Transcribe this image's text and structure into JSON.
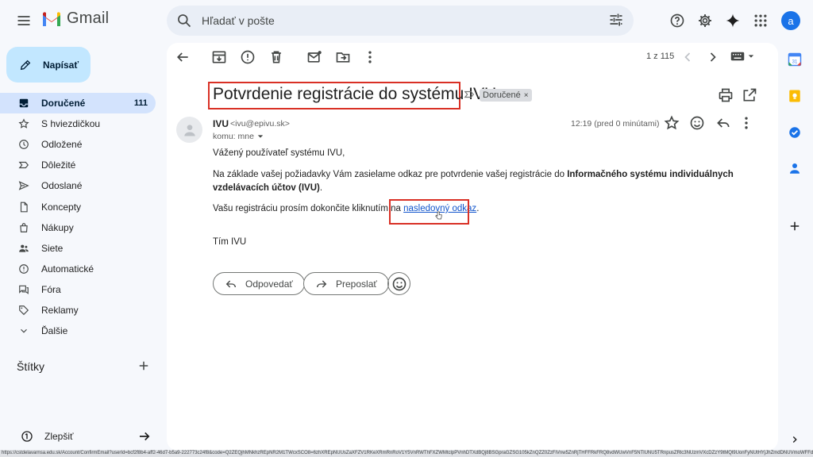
{
  "app": {
    "name": "Gmail",
    "brand_colors": {
      "red": "#ea4335",
      "blue": "#4285f4",
      "green": "#34a853",
      "yellow": "#fbbc04"
    }
  },
  "header": {
    "search_placeholder": "Hľadať v pošte",
    "account_initial": "a"
  },
  "compose": {
    "label": "Napísať"
  },
  "sidebar": {
    "items": [
      {
        "label": "Doručené",
        "count": "111",
        "icon": "inbox-icon",
        "active": true
      },
      {
        "label": "S hviezdičkou",
        "count": "",
        "icon": "star-icon",
        "active": false
      },
      {
        "label": "Odložené",
        "count": "",
        "icon": "clock-icon",
        "active": false
      },
      {
        "label": "Dôležité",
        "count": "",
        "icon": "important-icon",
        "active": false
      },
      {
        "label": "Odoslané",
        "count": "",
        "icon": "send-icon",
        "active": false
      },
      {
        "label": "Koncepty",
        "count": "",
        "icon": "draft-icon",
        "active": false
      },
      {
        "label": "Nákupy",
        "count": "",
        "icon": "shopping-icon",
        "active": false
      },
      {
        "label": "Siete",
        "count": "",
        "icon": "social-icon",
        "active": false
      },
      {
        "label": "Automatické",
        "count": "",
        "icon": "updates-icon",
        "active": false
      },
      {
        "label": "Fóra",
        "count": "",
        "icon": "forums-icon",
        "active": false
      },
      {
        "label": "Reklamy",
        "count": "",
        "icon": "tag-icon",
        "active": false
      },
      {
        "label": "Ďalšie",
        "count": "",
        "icon": "chevron-down-icon",
        "active": false
      }
    ],
    "labels_title": "Štítky",
    "upgrade_label": "Zlepšiť"
  },
  "toolbar": {
    "page_count": "1 z 115"
  },
  "message": {
    "subject": "Potvrdenie registrácie do systému IVU",
    "label_chip": "Doručené",
    "sender_name": "IVU",
    "sender_email": "<ivu@epivu.sk>",
    "recipient": "komu: mne",
    "time": "12:19 (pred 0 minútami)",
    "greeting": "Vážený používateľ systému IVU,",
    "para1_start": "Na základe vašej požiadavky Vám zasielame odkaz pre potvrdenie vašej registrácie do ",
    "para1_bold": "Informačného systému individuálnych vzdelávacích účtov (IVU)",
    "para1_end": ".",
    "para2_start": "Vašu registráciu prosím dokončite kliknutím na ",
    "link_text": "nasledovný odkaz",
    "para2_end": ".",
    "signature": "Tím IVU"
  },
  "actions": {
    "reply": "Odpovedať",
    "forward": "Preposlať"
  },
  "statusbar": {
    "url": "https://cstdelavarnsa.edu.sk/Account/ConfirmEmail?userId=bcf2f8b4-aff2-46d7-b5a9-222773c24f8&code=Q2ZEQjhMNkhzREpNR2M1TWcxSCO8=6zhXREpNUUsZaXFZV1RKeXRmRnRoV1Y5VnRWThFXZWMtclpPVnhDTXdBQj8BSGpraGZSG105kZnQZZ0ZzFiVnw5ZnRjTHFFRkFRQ8vdWUwVnF5NTlUNU5TRnpusZRlc3NUzmVXcDZzY9tMQl9UonFyNUtHYjJhZmdDNUVmoWFFd2NTVytZZHpCQ25tNcsdnZ5YmZtS..."
  }
}
